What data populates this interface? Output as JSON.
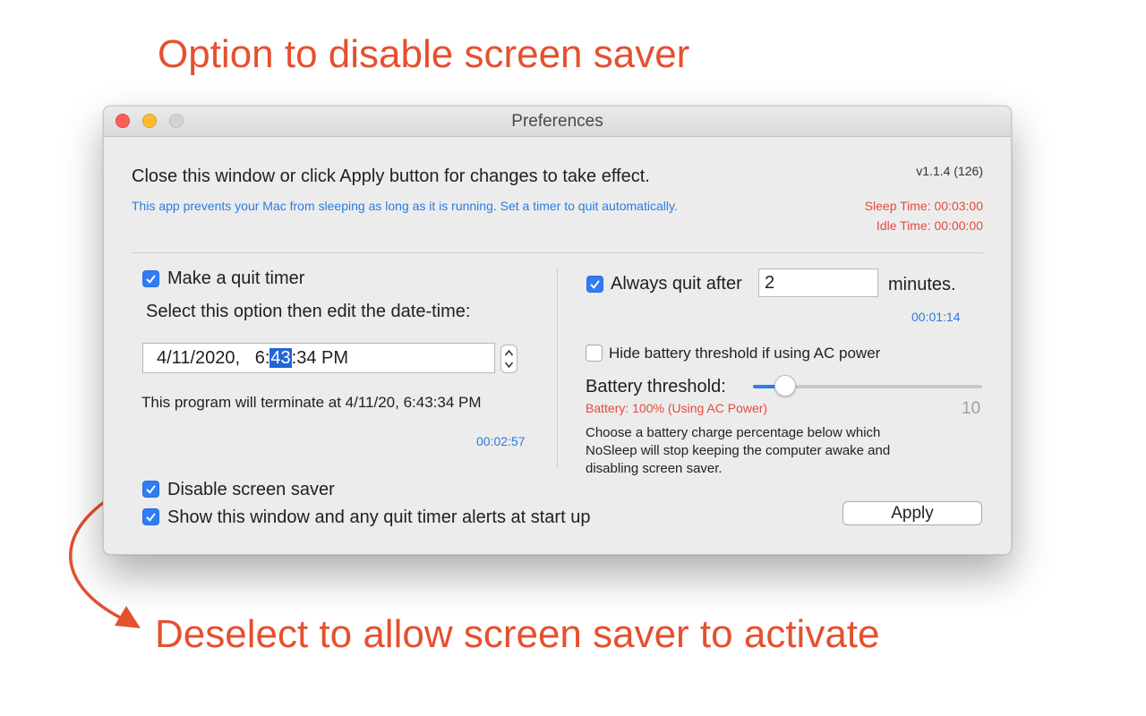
{
  "annotations": {
    "top": "Option to disable screen saver",
    "bottom": "Deselect to allow screen saver to activate",
    "color": "#e5502f"
  },
  "window": {
    "title": "Preferences",
    "traffic_lights": [
      "close-button",
      "minimize-button",
      "zoom-button"
    ]
  },
  "header": {
    "instruction": "Close this window or click Apply button for changes to take effect.",
    "description": "This app prevents your Mac from sleeping as long as it is running. Set a timer to quit automatically.",
    "version": "v1.1.4 (126)",
    "sleep_time": "Sleep Time: 00:03:00",
    "idle_time": "Idle Time: 00:00:00"
  },
  "left": {
    "quit_timer": {
      "label": "Make a quit timer",
      "checked": true
    },
    "select_hint": "Select this option then edit the date-time:",
    "datetime": {
      "before": "4/11/2020,   6:",
      "selected": "43",
      "after": ":34 PM"
    },
    "terminate_text": "This program will terminate at 4/11/20, 6:43:34 PM",
    "countdown": "00:02:57"
  },
  "right": {
    "always_quit": {
      "label": "Always quit after",
      "checked": true,
      "value": "2",
      "unit": "minutes."
    },
    "countdown": "00:01:14",
    "hide_battery": {
      "label": "Hide battery threshold if using AC power",
      "checked": false
    },
    "battery_threshold": {
      "label": "Battery threshold:",
      "level": 0.14,
      "max_label": "10",
      "status": "Battery: 100% (Using AC Power)",
      "description_lines": [
        "Choose a battery charge percentage below which",
        "NoSleep will stop keeping the computer awake and",
        "disabling screen saver."
      ]
    }
  },
  "footer": {
    "disable_screen_saver": {
      "label": "Disable screen saver",
      "checked": true
    },
    "show_window": {
      "label": "Show this window and any quit timer alerts at start up",
      "checked": true
    },
    "apply_label": "Apply"
  },
  "colors": {
    "accent": "#2f7cf5",
    "link_blue": "#2a7be3",
    "warning_red": "#e64a3c"
  }
}
